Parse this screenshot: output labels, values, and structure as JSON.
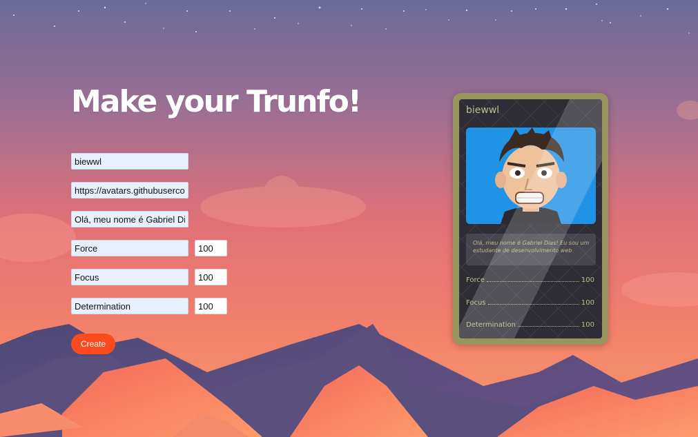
{
  "page": {
    "title": "Make your Trunfo!"
  },
  "form": {
    "name_value": "biewwl",
    "image_value": "https://avatars.githubusercontent.com",
    "description_value": "Olá, meu nome é Gabriel Dias! Eu sou um estudante de desenvolvimento web",
    "attributes": [
      {
        "name": "Force",
        "value": "100"
      },
      {
        "name": "Focus",
        "value": "100"
      },
      {
        "name": "Determination",
        "value": "100"
      }
    ],
    "create_label": "Create"
  },
  "card": {
    "name": "biewwl",
    "description": "Olá, meu nome é Gabriel Dias! Eu sou um estudante de desenvolvimento web",
    "attributes": [
      {
        "name": "Force",
        "value": "100"
      },
      {
        "name": "Focus",
        "value": "100"
      },
      {
        "name": "Determination",
        "value": "100"
      }
    ]
  },
  "colors": {
    "accent": "#fa4a1e",
    "card_frame": "#98965e",
    "card_text": "#bdba86",
    "sky_top": "#6d6a97",
    "sky_bottom": "#f08a6a"
  }
}
